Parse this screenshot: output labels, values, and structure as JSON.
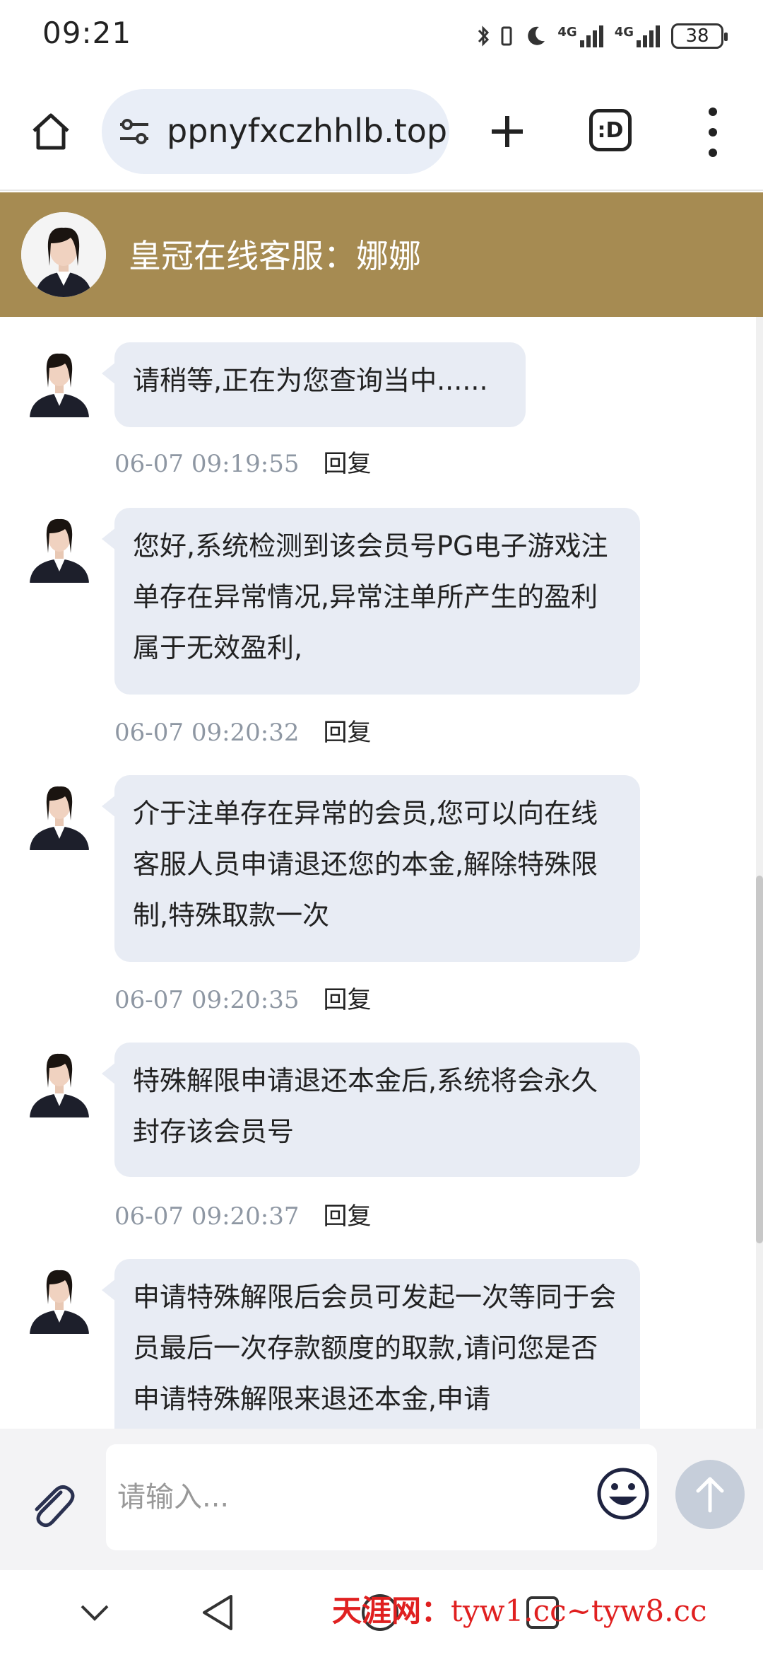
{
  "status_bar": {
    "time": "09:21",
    "network_1": "4G",
    "network_2": "4G",
    "battery": "38"
  },
  "browser": {
    "url": "ppnyfxczhhlb.top",
    "tab_switcher_label": ":D"
  },
  "chat": {
    "title": "皇冠在线客服：娜娜",
    "reply_label": "回复",
    "messages": [
      {
        "text": "请稍等,正在为您查询当中......",
        "time": "06-07 09:19:55"
      },
      {
        "text": "您好,系统检测到该会员号PG电子游戏注单存在异常情况,异常注单所产生的盈利属于无效盈利,",
        "time": "06-07 09:20:32"
      },
      {
        "text": "介于注单存在异常的会员,您可以向在线客服人员申请退还您的本金,解除特殊限制,特殊取款一次",
        "time": "06-07 09:20:35"
      },
      {
        "text": "特殊解限申请退还本金后,系统将会永久封存该会员号",
        "time": "06-07 09:20:37"
      },
      {
        "text": "申请特殊解限后会员可发起一次等同于会员最后一次存款额度的取款,请问您是否申请特殊解限来退还本金,申请",
        "time": ""
      }
    ]
  },
  "input": {
    "placeholder": "请输入..."
  },
  "watermark": {
    "site": "天涯网：",
    "urls": "tyw1.cc~tyw8.cc"
  },
  "icons": {
    "home": "home-icon",
    "site_settings": "tune-icon",
    "new_tab": "plus-icon",
    "menu": "more-vert-icon",
    "attach": "paperclip-icon",
    "emoji": "smile-icon",
    "send": "arrow-up-icon",
    "nav_back": "triangle-back-icon",
    "nav_home": "circle-home-icon",
    "nav_recent": "square-recent-icon",
    "nav_collapse": "chevron-down-icon"
  },
  "colors": {
    "header": "#a68b52",
    "bubble": "#e8ecf4",
    "input_bg": "#f3f3f5",
    "send": "#c6ceda",
    "url_box": "#e9eef7"
  }
}
